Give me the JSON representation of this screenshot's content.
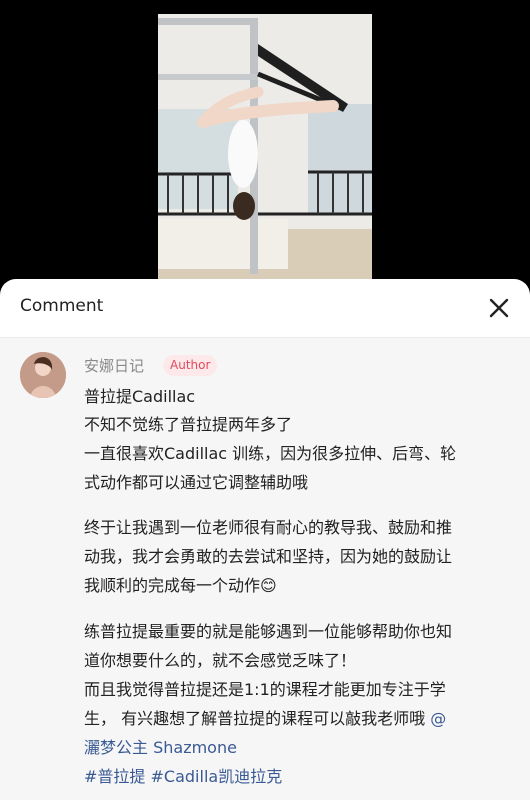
{
  "header": {
    "title": "Comment",
    "close_icon": "close-icon"
  },
  "comment": {
    "username": "安娜日记",
    "badge": "Author",
    "lines": {
      "l1": "普拉提Cadillac",
      "l2": "不知不觉练了普拉提两年多了",
      "l3": "一直很喜欢Cadillac 训练，因为很多拉伸、后弯、轮",
      "l4": "式动作都可以通过它调整辅助哦",
      "l5": "终于让我遇到一位老师很有耐心的教导我、鼓励和推",
      "l6": "动我，我才会勇敢的去尝试和坚持，因为她的鼓励让",
      "l7": "我顺利的完成每一个动作",
      "l8": "练普拉提最重要的就是能够遇到一位能够帮助你也知",
      "l9": "道你想要什么的，就不会感觉乏味了！",
      "l10": "而且我觉得普拉提还是1:1的课程才能更加专注于学",
      "l11": "生，  有兴趣想了解普拉提的课程可以敲我老师哦",
      "l11_mention": "@",
      "l12_mention": "灑梦公主 Shazmone",
      "hashtag1": "#普拉提",
      "hashtag2": "#Cadilla凯迪拉克"
    },
    "emoji": "😊"
  },
  "colors": {
    "accent_badge_bg": "#fde8ea",
    "accent_badge_text": "#e34b5f",
    "link": "#3a5a93"
  }
}
